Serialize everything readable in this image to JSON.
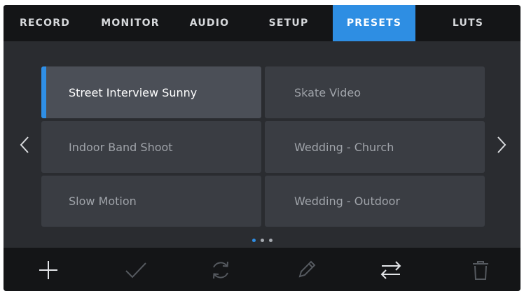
{
  "tabs": [
    {
      "label": "RECORD"
    },
    {
      "label": "MONITOR"
    },
    {
      "label": "AUDIO"
    },
    {
      "label": "SETUP"
    },
    {
      "label": "PRESETS"
    },
    {
      "label": "LUTS"
    }
  ],
  "active_tab": "PRESETS",
  "presets": [
    {
      "name": "Street Interview Sunny"
    },
    {
      "name": "Skate Video"
    },
    {
      "name": "Indoor Band Shoot"
    },
    {
      "name": "Wedding  - Church"
    },
    {
      "name": "Slow Motion"
    },
    {
      "name": "Wedding - Outdoor"
    }
  ],
  "selected_preset": "Street Interview Sunny",
  "pagination": {
    "current_page": 1,
    "total_pages": 3
  },
  "toolbar_icons": [
    "plus-icon",
    "checkmark-icon",
    "refresh-icon",
    "pencil-icon",
    "swap-arrows-icon",
    "trash-icon"
  ],
  "colors": {
    "accent": "#2e8ee3",
    "tab_bar": "#141517",
    "background": "#2a2c30",
    "preset_tile": "#3a3d43",
    "preset_selected": "#4b4f57"
  }
}
